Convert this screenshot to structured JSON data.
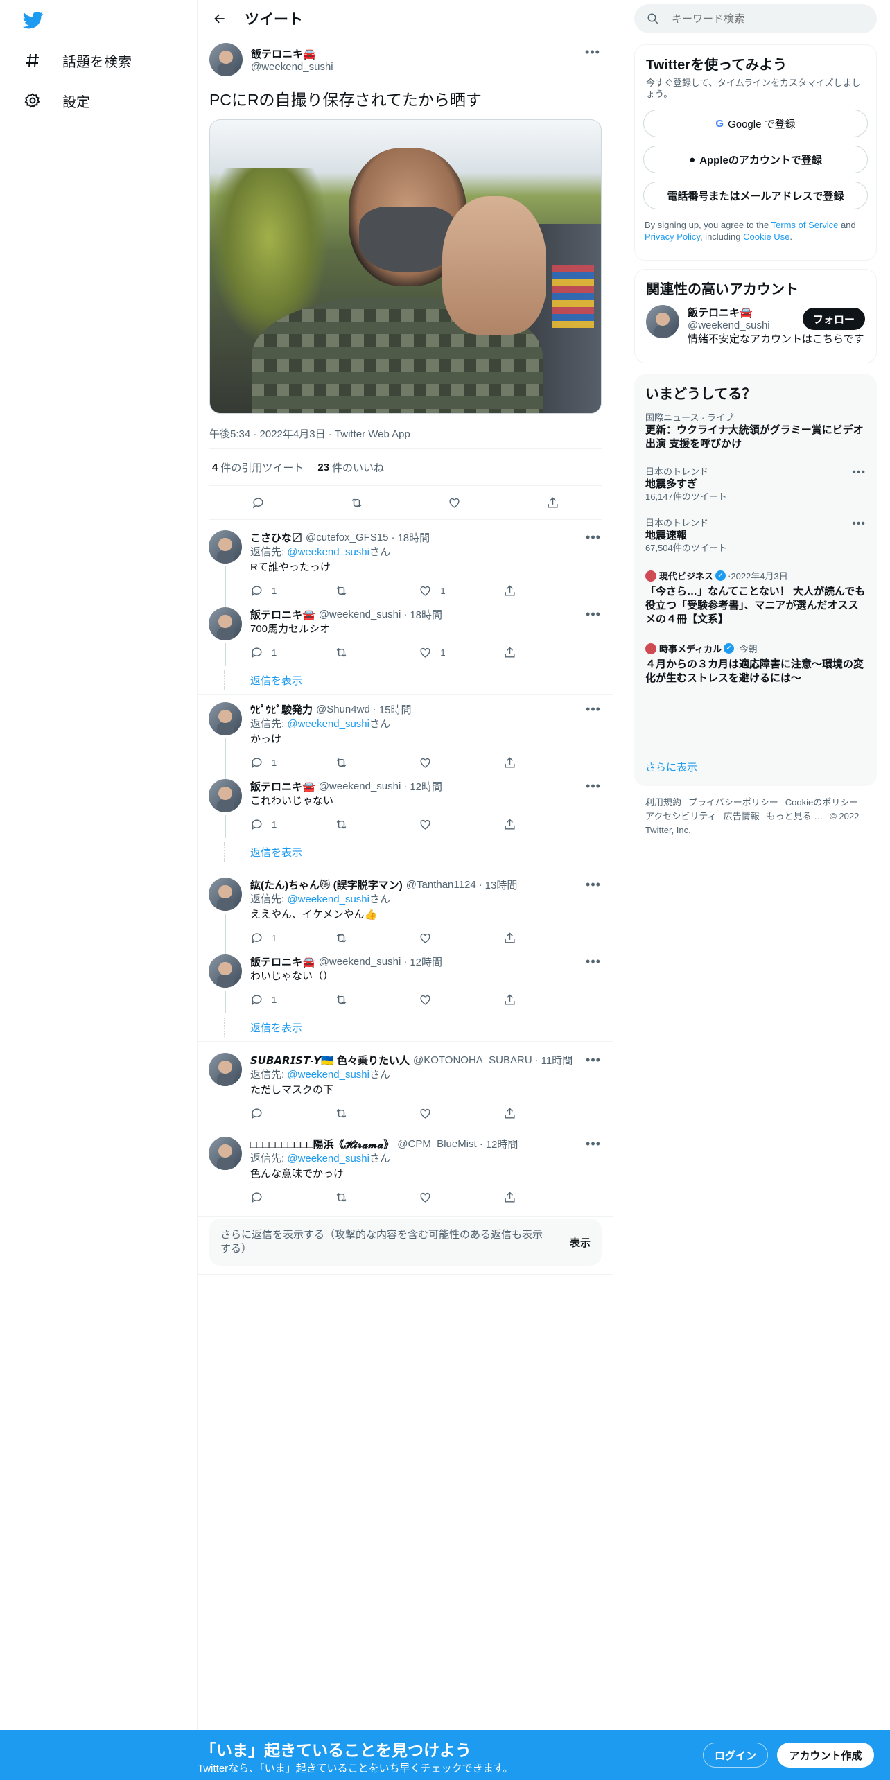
{
  "nav": {
    "explore_label": "話題を検索",
    "settings_label": "設定"
  },
  "header": {
    "title": "ツイート"
  },
  "main_tweet": {
    "name": "飯テロニキ🚘",
    "handle": "@weekend_sushi",
    "text": "PCにRの自撮り保存されてたから晒す",
    "meta": "午後5:34 · 2022年4月3日 · Twitter Web App",
    "quote_count": "4",
    "quote_label": "件の引用ツイート",
    "like_count": "23",
    "like_label": "件のいいね"
  },
  "reply_to_label": "返信先:",
  "san_suffix": "さん",
  "show_replies_label": "返信を表示",
  "threads": [
    {
      "replies": [
        {
          "name": "こさひな〼",
          "handle": "@cutefox_GFS15",
          "time": "18時間",
          "reply_to": "@weekend_sushi",
          "text": "Rて誰やったっけ",
          "reply_count": "1",
          "retweet_count": "",
          "like_count": "1"
        },
        {
          "name": "飯テロニキ🚘",
          "handle": "@weekend_sushi",
          "time": "18時間",
          "reply_to": "",
          "text": "700馬力セルシオ",
          "reply_count": "1",
          "retweet_count": "",
          "like_count": "1"
        }
      ]
    },
    {
      "replies": [
        {
          "name": "ｳﾋﾟｳﾋﾟ駿発力",
          "handle": "@Shun4wd",
          "time": "15時間",
          "reply_to": "@weekend_sushi",
          "text": "かっけ",
          "reply_count": "1",
          "retweet_count": "",
          "like_count": ""
        },
        {
          "name": "飯テロニキ🚘",
          "handle": "@weekend_sushi",
          "time": "12時間",
          "reply_to": "",
          "text": "これわいじゃない",
          "reply_count": "1",
          "retweet_count": "",
          "like_count": ""
        }
      ]
    },
    {
      "replies": [
        {
          "name": "紘(たん)ちゃん😿 (誤字脱字マン)",
          "handle": "@Tanthan1124",
          "time": "13時間",
          "reply_to": "@weekend_sushi",
          "text": "ええやん、イケメンやん👍",
          "reply_count": "1",
          "retweet_count": "",
          "like_count": ""
        },
        {
          "name": "飯テロニキ🚘",
          "handle": "@weekend_sushi",
          "time": "12時間",
          "reply_to": "",
          "text": "わいじゃない（）",
          "reply_count": "1",
          "retweet_count": "",
          "like_count": ""
        }
      ]
    },
    {
      "replies": [
        {
          "name": "𝙎𝙐𝘽𝘼𝙍𝙄𝙎𝙏-𝙔🇺🇦 色々乗りたい人",
          "handle": "@KOTONOHA_SUBARU",
          "time": "11時間",
          "reply_to": "@weekend_sushi",
          "text": "ただしマスクの下",
          "reply_count": "",
          "retweet_count": "",
          "like_count": ""
        }
      ]
    },
    {
      "replies": [
        {
          "name": "□□□□□□□□□□陽浜《𝓗𝓲𝓻𝓪𝓶𝓪》",
          "handle": "@CPM_BlueMist",
          "time": "12時間",
          "reply_to": "@weekend_sushi",
          "text": "色んな意味でかっけ",
          "reply_count": "",
          "retweet_count": "",
          "like_count": ""
        }
      ]
    }
  ],
  "more_replies": {
    "text": "さらに返信を表示する（攻撃的な内容を含む可能性のある返信も表示する）",
    "button": "表示"
  },
  "search": {
    "placeholder": "キーワード検索"
  },
  "signup": {
    "title": "Twitterを使ってみよう",
    "note": "今すぐ登録して、タイムラインをカスタマイズしましょう。",
    "google": "Google で登録",
    "apple": "Appleのアカウントで登録",
    "phone": "電話番号またはメールアドレスで登録",
    "terms_pre": "By signing up, you agree to the ",
    "terms_link": "Terms of Service",
    "terms_and": " and ",
    "privacy_link": "Privacy Policy",
    "terms_inc": ", including ",
    "cookie_link": "Cookie Use",
    "terms_end": "."
  },
  "related": {
    "title": "関連性の高いアカウント",
    "name": "飯テロニキ🚘",
    "handle": "@weekend_sushi",
    "bio": "情緒不安定なアカウントはこちらです",
    "follow": "フォロー"
  },
  "trends": {
    "title": "いまどうしてる？",
    "items": [
      {
        "context": "国際ニュース · ライブ",
        "title": "更新：ウクライナ大統領がグラミー賞にビデオ出演 支援を呼びかけ",
        "count": ""
      },
      {
        "context": "日本のトレンド",
        "title": "地震多すぎ",
        "count": "16,147件のツイート"
      },
      {
        "context": "日本のトレンド",
        "title": "地震速報",
        "count": "67,504件のツイート"
      }
    ],
    "news": [
      {
        "source": "現代ビジネス",
        "time": "2022年4月3日",
        "title": "「今さら…」なんてことない！ 大人が読んでも役立つ「受験参考書」、マニアが選んだオススメの４冊【文系】"
      },
      {
        "source": "時事メディカル",
        "time": "今朝",
        "title": "４月からの３カ月は適応障害に注意～環境の変化が生むストレスを避けるには～"
      }
    ],
    "show_more": "さらに表示"
  },
  "footer": {
    "links": [
      "利用規約",
      "プライバシーポリシー",
      "Cookieのポリシー",
      "アクセシビリティ",
      "広告情報",
      "もっと見る …",
      "© 2022 Twitter, Inc."
    ]
  },
  "bottom_bar": {
    "headline": "「いま」起きていることを見つけよう",
    "sub": "Twitterなら、「いま」起きていることをいち早くチェックできます。",
    "login": "ログイン",
    "signup": "アカウント作成"
  },
  "colors": {
    "accent": "#1d9bf0",
    "text": "#0f1419",
    "muted": "#536471",
    "border": "#eff3f4"
  }
}
